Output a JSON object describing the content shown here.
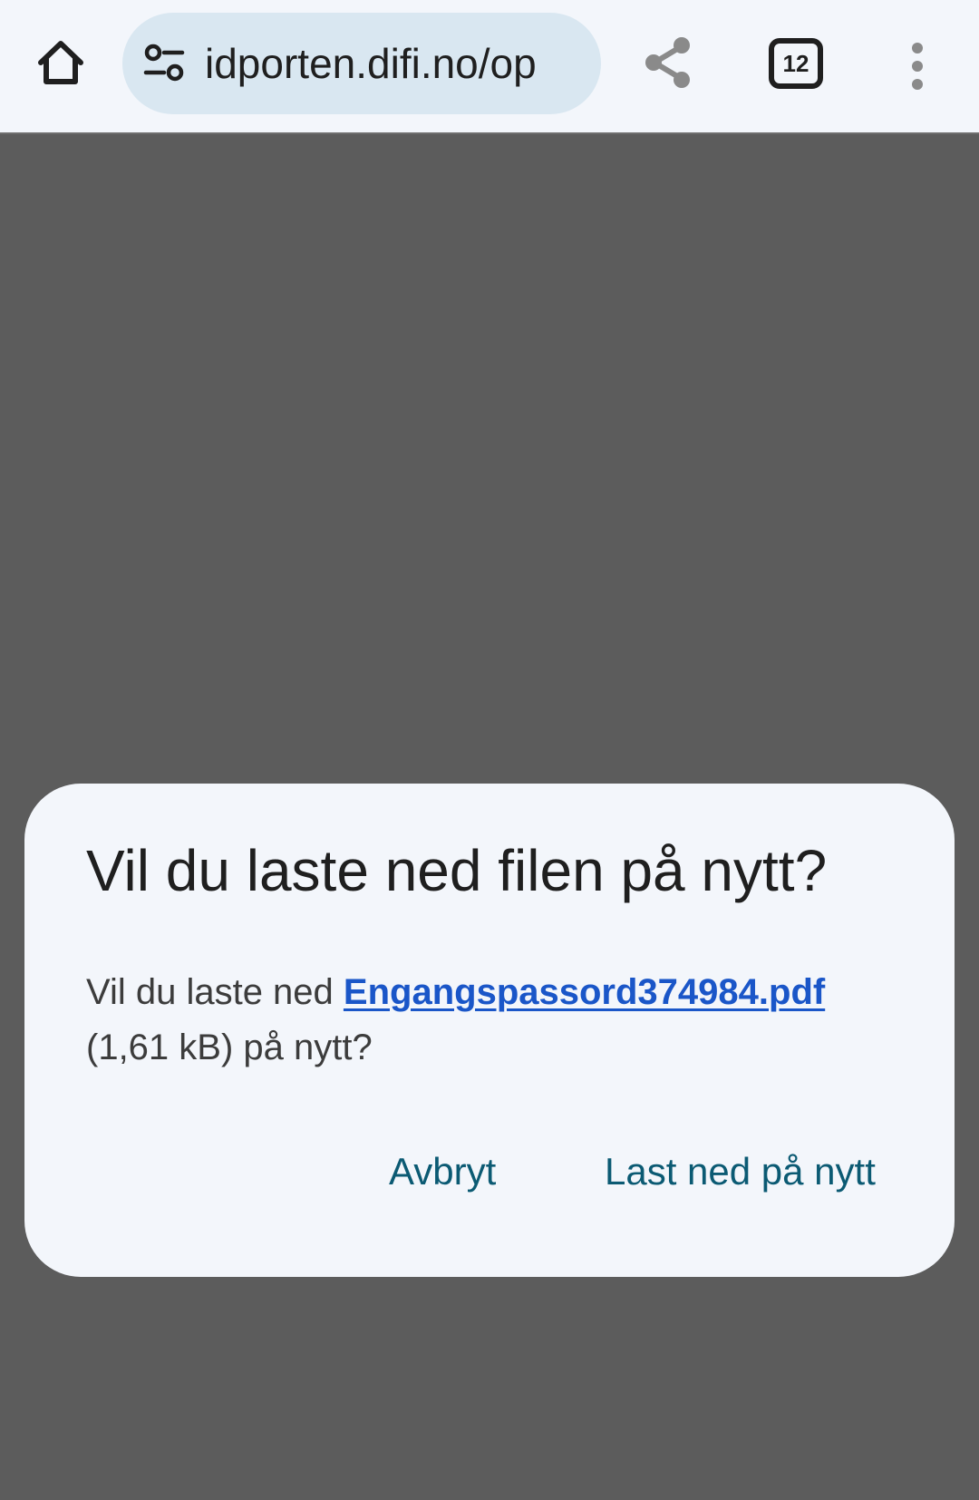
{
  "toolbar": {
    "url": "idporten.difi.no/op",
    "tab_count": "12",
    "icons": {
      "home": "home-icon",
      "site_info": "tune-icon",
      "share": "share-icon",
      "tabs": "tabs-icon",
      "menu": "more-vert-icon"
    }
  },
  "dialog": {
    "title": "Vil du laste ned filen på nytt?",
    "body_prefix": "Vil du laste ned ",
    "file_name": "Engangspassord374984.pdf",
    "body_suffix": " (1,61 kB) på nytt?",
    "cancel_label": "Avbryt",
    "confirm_label": "Last ned på nytt"
  },
  "colors": {
    "toolbar_bg": "#f3f6fb",
    "urlbar_bg": "#d9e7f1",
    "scrim": "#5c5c5c",
    "dialog_bg": "#f3f6fb",
    "link": "#1a56c8",
    "button_text": "#0b5a73"
  }
}
